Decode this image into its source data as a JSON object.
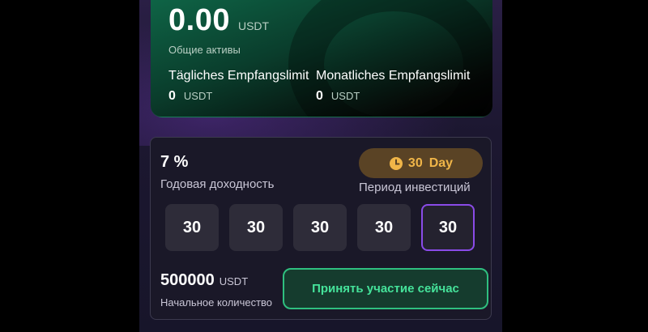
{
  "asset_card": {
    "balance": "0.00",
    "balance_unit": "USDT",
    "total_label": "Общие активы",
    "daily_limit_label": "Tägliches Empfangslimit",
    "monthly_limit_label": "Monatliches Empfangslimit",
    "daily_limit_value": "0",
    "daily_limit_unit": "USDT",
    "monthly_limit_value": "0",
    "monthly_limit_unit": "USDT"
  },
  "product": {
    "rate": "7  %",
    "rate_label": "Годовая доходность",
    "period_value": "30",
    "period_unit": "Day",
    "period_label": "Период инвестиций",
    "period_icon": "clock-icon",
    "day_options": [
      "30",
      "30",
      "30",
      "30",
      "30"
    ],
    "selected_option_index": 4,
    "amount": "500000",
    "amount_unit": "USDT",
    "amount_label": "Начальное количество",
    "join_button_label": "Принять участие сейчас"
  },
  "colors": {
    "accent_green": "#45e29a",
    "accent_purple": "#8a4be8",
    "badge_gold": "#f0b548"
  }
}
